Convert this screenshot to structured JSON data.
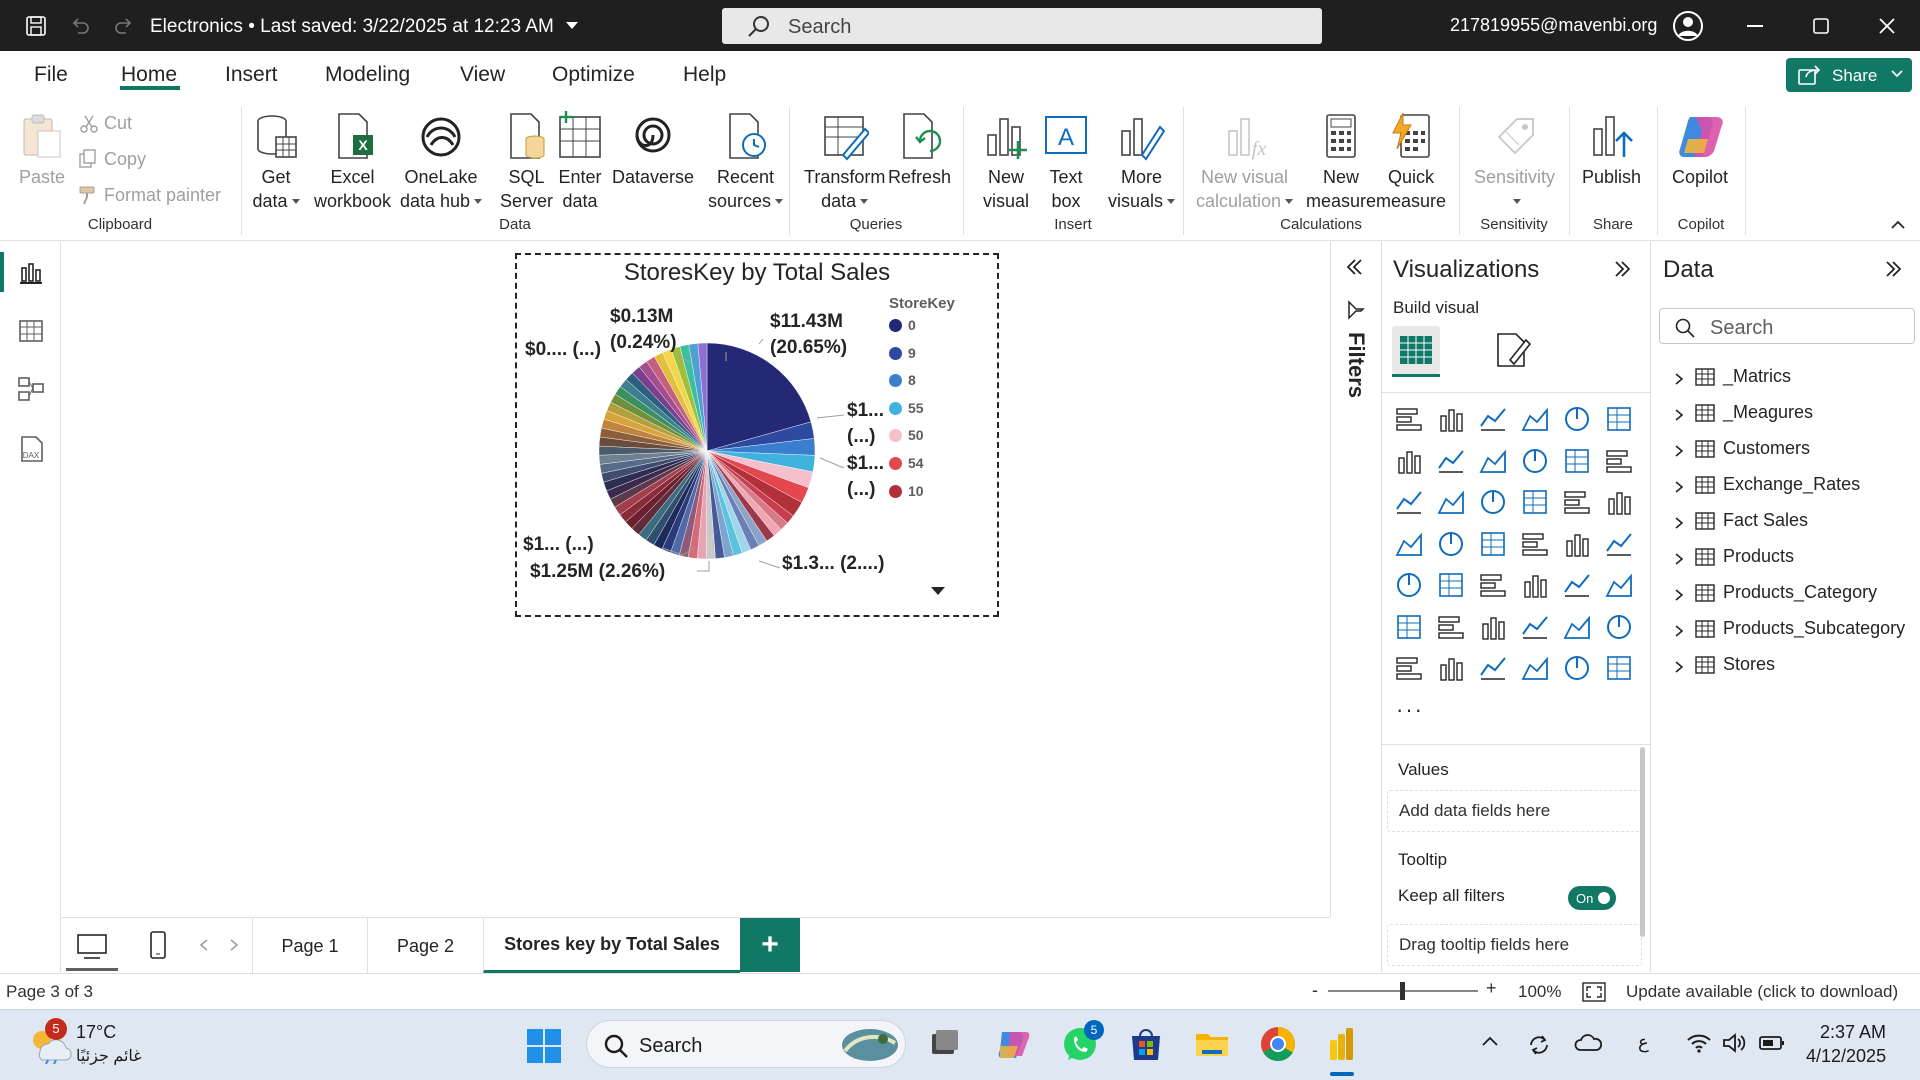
{
  "window": {
    "title": "Electronics • Last saved: 3/22/2025 at 12:23 AM",
    "search_placeholder": "Search",
    "user_email": "217819955@mavenbi.org"
  },
  "menu": {
    "tabs": [
      "File",
      "Home",
      "Insert",
      "Modeling",
      "View",
      "Optimize",
      "Help"
    ],
    "active": "Home",
    "share_label": "Share"
  },
  "ribbon": {
    "clipboard": {
      "paste": "Paste",
      "cut": "Cut",
      "copy": "Copy",
      "format_painter": "Format painter",
      "label": "Clipboard"
    },
    "data": {
      "get_data": [
        "Get",
        "data"
      ],
      "excel": [
        "Excel",
        "workbook"
      ],
      "onelake": [
        "OneLake",
        "data hub"
      ],
      "sql": [
        "SQL",
        "Server"
      ],
      "enter": [
        "Enter",
        "data"
      ],
      "dataverse": "Dataverse",
      "recent": [
        "Recent",
        "sources"
      ],
      "label": "Data"
    },
    "queries": {
      "transform": [
        "Transform",
        "data"
      ],
      "refresh": "Refresh",
      "label": "Queries"
    },
    "insert": {
      "new_visual": [
        "New",
        "visual"
      ],
      "text_box": [
        "Text",
        "box"
      ],
      "more_visuals": [
        "More",
        "visuals"
      ],
      "label": "Insert"
    },
    "calculations": {
      "new_visual_calc": [
        "New visual",
        "calculation"
      ],
      "new_measure": [
        "New",
        "measure"
      ],
      "quick_measure": [
        "Quick",
        "measure"
      ],
      "label": "Calculations"
    },
    "sensitivity": {
      "button": "Sensitivity",
      "label": "Sensitivity"
    },
    "share": {
      "publish": "Publish",
      "label": "Share"
    },
    "copilot": {
      "button": "Copilot",
      "label": "Copilot"
    }
  },
  "visual": {
    "title": "StoresKey by Total Sales",
    "legend_title": "StoreKey",
    "legend": [
      {
        "label": "0",
        "color": "#252874"
      },
      {
        "label": "9",
        "color": "#2e4aa0"
      },
      {
        "label": "8",
        "color": "#3a7fcf"
      },
      {
        "label": "55",
        "color": "#3db3dd"
      },
      {
        "label": "50",
        "color": "#f6bfcc"
      },
      {
        "label": "54",
        "color": "#e5474f"
      },
      {
        "label": "10",
        "color": "#b2303a"
      }
    ],
    "data_labels": {
      "top_right_1": "$11.43M",
      "top_right_2": "(20.65%)",
      "top_mid_1": "$0.13M",
      "top_mid_2": "(0.24%)",
      "top_left": "$0.... (...)",
      "right_a_1": "$1...",
      "right_a_2": "(...)",
      "right_b_1": "$1...",
      "right_b_2": "(...)",
      "bottom_left": "$1... (...)",
      "bottom": "$1.25M (2.26%)",
      "bottom_right": "$1.3... (2....)"
    }
  },
  "chart_data": {
    "type": "pie",
    "title": "StoresKey by Total Sales",
    "legend_title": "StoreKey",
    "slices": [
      {
        "label": "0",
        "value": 11.43,
        "percent": 20.65,
        "color": "#252874"
      },
      {
        "label": "9",
        "value": 1.4,
        "percent": 2.5,
        "color": "#2e4aa0"
      },
      {
        "label": "8",
        "value": 1.38,
        "percent": 2.5,
        "color": "#3a7fcf"
      },
      {
        "label": "55",
        "value": 1.36,
        "percent": 2.45,
        "color": "#3db3dd"
      },
      {
        "label": "50",
        "value": 1.34,
        "percent": 2.42,
        "color": "#f6bfcc"
      },
      {
        "label": "54",
        "value": 1.32,
        "percent": 2.4,
        "color": "#e5474f"
      },
      {
        "label": "10",
        "value": 1.3,
        "percent": 2.35,
        "color": "#b2303a"
      }
    ],
    "other_slice_colors": [
      "#c73f4f",
      "#d87b88",
      "#f0a6b3",
      "#9a3948",
      "#8da3c9",
      "#6a7fb6",
      "#a0d4e8",
      "#5cc3df",
      "#7fa4cf",
      "#465a9a",
      "#c9c9c9",
      "#e6a4b4",
      "#d36b78",
      "#8e5a7a",
      "#4f6aa8",
      "#2a3a7a",
      "#1c2b5a",
      "#2f4f6f",
      "#3d6b7f",
      "#5e2c3c",
      "#6e1f2f",
      "#872c3b",
      "#a33d4b",
      "#5d3a4a",
      "#3b2a4f",
      "#2b2d52",
      "#3f4c6b",
      "#566b8a",
      "#70808f",
      "#4b5b6b",
      "#6b4b3b",
      "#8b5e3c",
      "#c0843d",
      "#d9a33c",
      "#b3a03c",
      "#6f8f3c",
      "#3c8f5f",
      "#3c7f8f",
      "#2f5f7f",
      "#7b3f8f",
      "#a34f8f",
      "#c45f7f",
      "#e0c03c",
      "#f2d64b",
      "#9fbf3c",
      "#3cbf9f",
      "#4f9fd4",
      "#8f6fd4"
    ]
  },
  "panes": {
    "filters_label": "Filters",
    "viz_title": "Visualizations",
    "build_visual": "Build visual",
    "more": "···",
    "values_label": "Values",
    "values_placeholder": "Add data fields here",
    "tooltip_label": "Tooltip",
    "keep_filters_label": "Keep all filters",
    "toggle_label": "On",
    "tooltip_placeholder": "Drag tooltip fields here",
    "data_title": "Data",
    "data_search_placeholder": "Search",
    "tables": [
      "_Matrics",
      "_Meagures",
      "Customers",
      "Exchange_Rates",
      "Fact Sales",
      "Products",
      "Products_Category",
      "Products_Subcategory",
      "Stores"
    ]
  },
  "pages": {
    "tabs": [
      "Page 1",
      "Page 2",
      "Stores key by Total Sales"
    ],
    "active": "Stores key by Total Sales",
    "add_label": "+"
  },
  "status": {
    "page_indicator": "Page 3 of 3",
    "zoom_minus": "-",
    "zoom_plus": "+",
    "zoom": "100%",
    "zoom_fraction": 0.5,
    "update_msg": "Update available (click to download)"
  },
  "taskbar": {
    "weather_badge": "5",
    "temperature": "17°C",
    "weather_desc": "غائم جزئيًا",
    "search_placeholder": "Search",
    "whatsapp_badge": "5",
    "lang": "ع",
    "time": "2:37 AM",
    "date": "4/12/2025"
  }
}
